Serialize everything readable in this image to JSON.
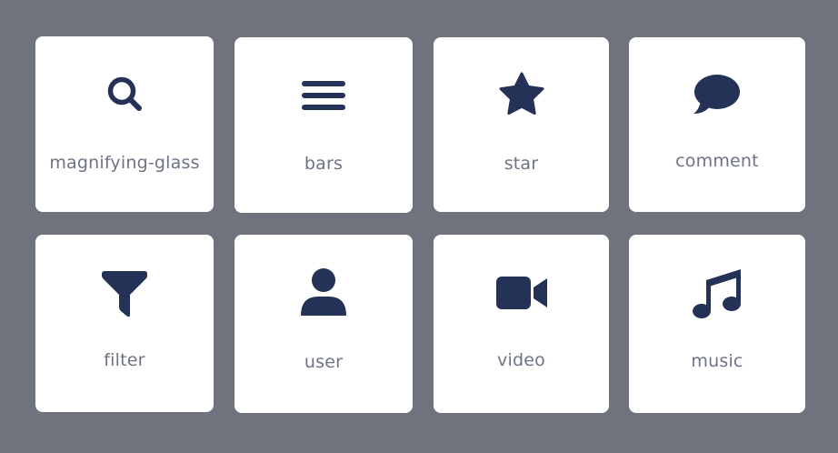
{
  "colors": {
    "background": "#6f737e",
    "card": "#ffffff",
    "icon": "#233256",
    "label": "#6e7385"
  },
  "icons": [
    {
      "name": "magnifying-glass",
      "icon": "magnifying-glass-icon"
    },
    {
      "name": "bars",
      "icon": "bars-icon"
    },
    {
      "name": "star",
      "icon": "star-icon"
    },
    {
      "name": "comment",
      "icon": "comment-icon"
    },
    {
      "name": "filter",
      "icon": "filter-icon"
    },
    {
      "name": "user",
      "icon": "user-icon"
    },
    {
      "name": "video",
      "icon": "video-icon"
    },
    {
      "name": "music",
      "icon": "music-icon"
    }
  ]
}
